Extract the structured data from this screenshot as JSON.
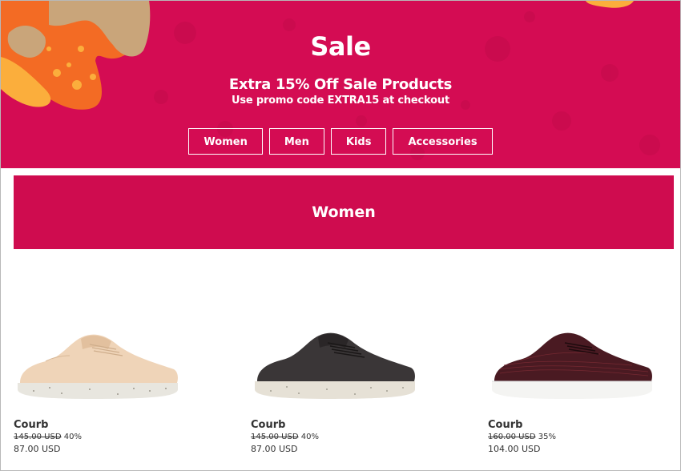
{
  "hero": {
    "title": "Sale",
    "subtitle": "Extra 15% Off Sale Products",
    "promo": "Use promo code EXTRA15 at checkout",
    "nav": [
      "Women",
      "Men",
      "Kids",
      "Accessories"
    ],
    "colors": {
      "background": "#d40c53",
      "accent_orange": "#f5821f",
      "accent_tan": "#c8a57a"
    }
  },
  "section": {
    "title": "Women",
    "color": "#cf0c4f"
  },
  "products": [
    {
      "name": "Courb",
      "old_price": "145.00  USD",
      "discount": "40%",
      "price": "87.00 USD",
      "color": "#efd4b8"
    },
    {
      "name": "Courb",
      "old_price": "145.00  USD",
      "discount": "40%",
      "price": "87.00 USD",
      "color": "#3a3637"
    },
    {
      "name": "Courb",
      "old_price": "160.00  USD",
      "discount": "35%",
      "price": "104.00 USD",
      "color": "#4a1a22"
    }
  ]
}
